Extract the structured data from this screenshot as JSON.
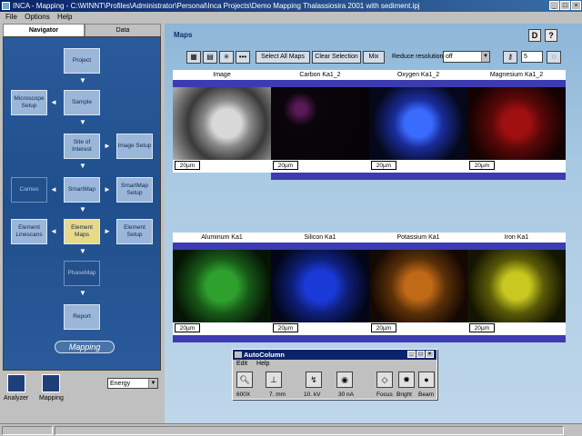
{
  "window": {
    "title": "INCA - Mapping - C:\\WINNT\\Profiles\\Administrator\\Personal\\Inca Projects\\Demo Mapping Thalassiosira 2001 with sediment.ipj"
  },
  "menu": {
    "file": "File",
    "options": "Options",
    "help": "Help"
  },
  "left_tabs": {
    "navigator": "Navigator",
    "data": "Data"
  },
  "navigator": {
    "project": "Project",
    "sample": "Sample",
    "microscope_setup": "Microscope Setup",
    "site_of_interest": "Site of Interest",
    "image_setup": "Image Setup",
    "cameo": "Cameo",
    "smartmap": "SmartMap",
    "smartmap_setup": "SmartMap Setup",
    "element_linescans": "Element Linescans",
    "element_maps": "Element Maps",
    "element_setup": "Element Setup",
    "phasemap": "PhaseMap",
    "report": "Report",
    "mapping": "Mapping"
  },
  "bottom_tools": {
    "analyzer": "Analyzer",
    "mapping": "Mapping",
    "mode_select": "Energy"
  },
  "main": {
    "title": "Maps",
    "toolbar": {
      "select_all": "Select All Maps",
      "clear_selection": "Clear Selection",
      "mix": "Mix",
      "reduce_label": "Reduce resolution",
      "reduce_value": "off",
      "spin_value": "5"
    },
    "row1": [
      "Image",
      "Carbon Ka1_2",
      "Oxygen Ka1_2",
      "Magnesium Ka1_2"
    ],
    "row2": [
      "Aluminum Ka1",
      "Silicon Ka1",
      "Potassium Ka1",
      "Iron Ka1"
    ],
    "scale": "20µm"
  },
  "autocolumn": {
    "title": "AutoColumn",
    "menu_edit": "Edit",
    "menu_help": "Help",
    "mag": "600X",
    "wd": "7. mm",
    "kv": "10. kV",
    "na": "30 nA",
    "focus": "Focus",
    "bright": "Bright",
    "beam": "Beam"
  },
  "colors": {
    "nav_bg": "#1f4f8c",
    "carbon": "#c040c0",
    "oxygen": "#3060ff",
    "magnesium": "#d02020",
    "aluminum": "#30c030",
    "silicon": "#2040e0",
    "potassium": "#e08020",
    "iron": "#e0e030"
  }
}
